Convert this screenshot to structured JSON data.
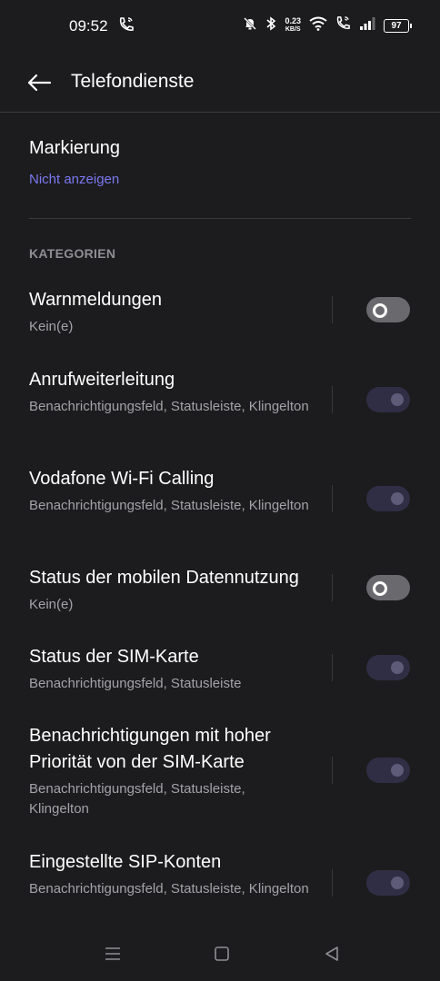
{
  "status_bar": {
    "time": "09:52",
    "data_speed_value": "0.23",
    "data_speed_unit": "KB/S",
    "battery": "97"
  },
  "header": {
    "title": "Telefondienste"
  },
  "marking": {
    "label": "Markierung",
    "value": "Nicht anzeigen"
  },
  "section_title": "KATEGORIEN",
  "categories": [
    {
      "title": "Warnmeldungen",
      "subtitle": "Kein(e)",
      "toggle": "off"
    },
    {
      "title": "Anrufweiterleitung",
      "subtitle": "Benachrichtigungsfeld, Statusleiste, Klingelton",
      "toggle": "on-disabled"
    },
    {
      "title": "Vodafone Wi-Fi Calling",
      "subtitle": "Benachrichtigungsfeld, Statusleiste, Klingelton",
      "toggle": "on-disabled"
    },
    {
      "title": "Status der mobilen Datennutzung",
      "subtitle": "Kein(e)",
      "toggle": "off"
    },
    {
      "title": "Status der SIM-Karte",
      "subtitle": "Benachrichtigungsfeld, Statusleiste",
      "toggle": "on-disabled"
    },
    {
      "title": "Benachrichtigungen mit hoher Priorität von der SIM-Karte",
      "subtitle": "Benachrichtigungsfeld, Statusleiste, Klingelton",
      "toggle": "on-disabled"
    },
    {
      "title": "Eingestellte SIP-Konten",
      "subtitle": "Benachrichtigungsfeld, Statusleiste, Klingelton",
      "toggle": "on-disabled"
    }
  ],
  "colors": {
    "background": "#1c1c1e",
    "accent": "#7b78f0",
    "toggle_disabled": "#302e45",
    "toggle_off": "#6a6a6e"
  }
}
